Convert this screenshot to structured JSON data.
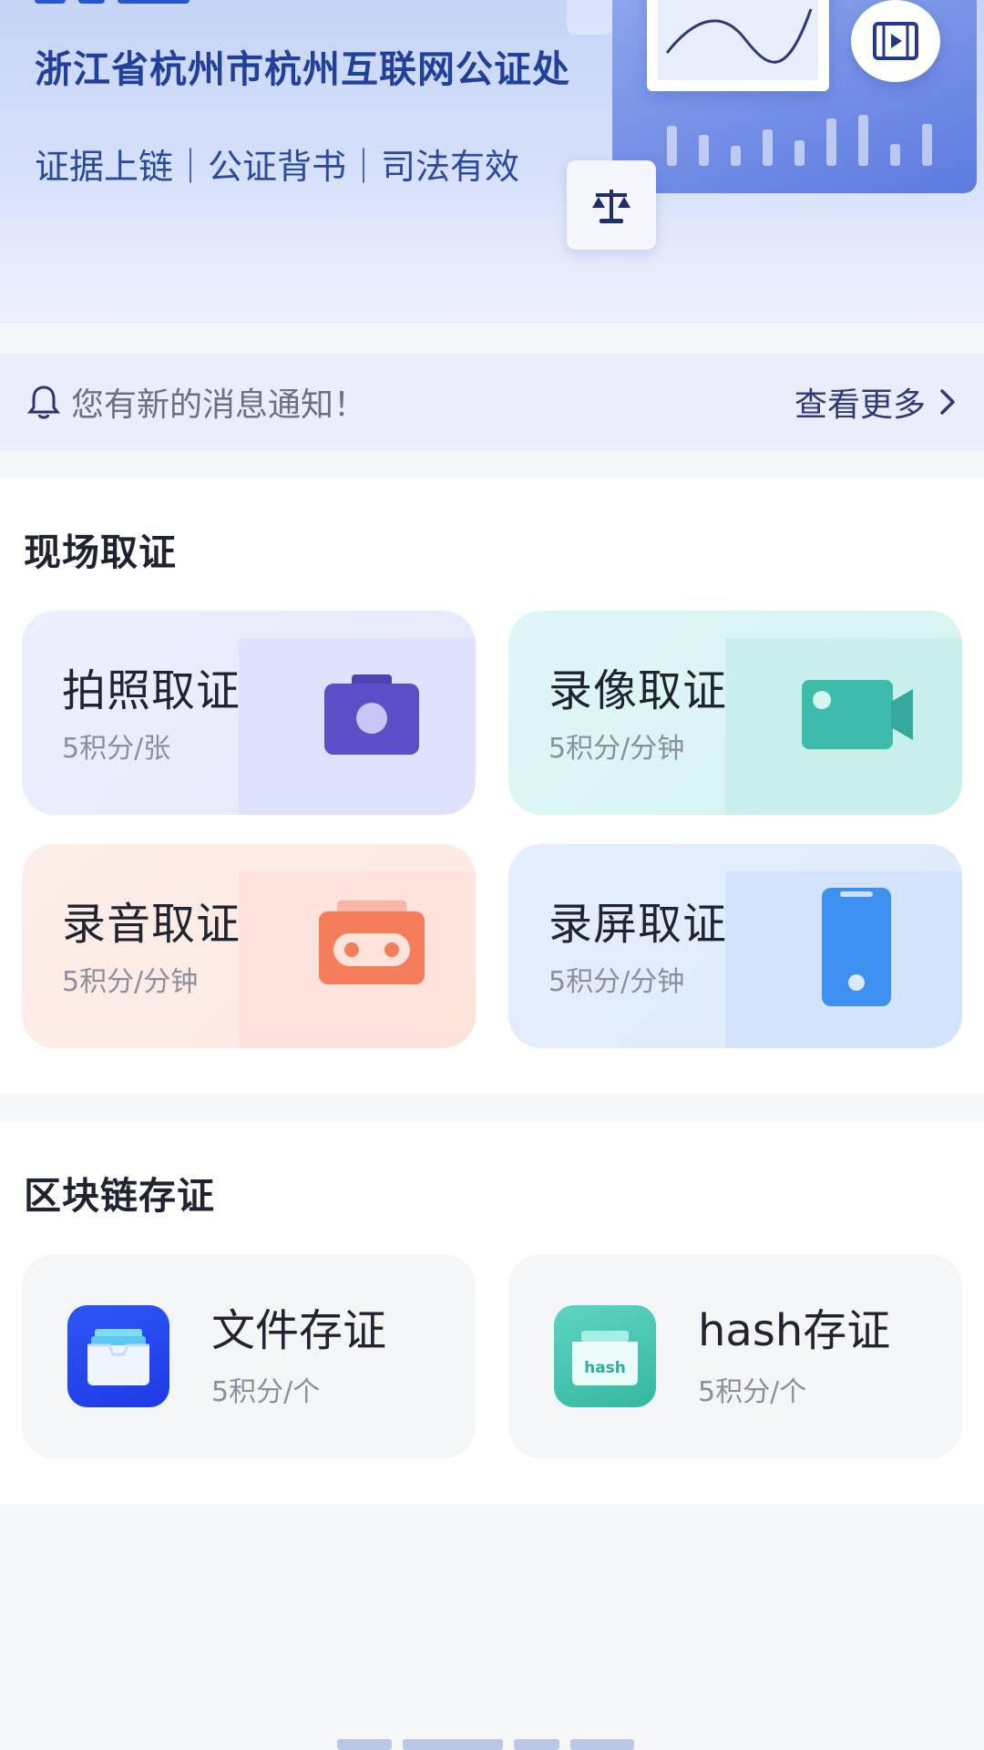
{
  "banner": {
    "organization": "浙江省杭州市杭州互联网公证处",
    "tags": "证据上链｜公证背书｜司法有效",
    "icons": [
      "chart-card",
      "film-icon",
      "scales-icon"
    ]
  },
  "notice": {
    "message": "您有新的消息通知！",
    "more_label": "查看更多",
    "icon": "bell-icon"
  },
  "onsite": {
    "title": "现场取证",
    "cards": [
      {
        "title": "拍照取证",
        "price": "5积分/张",
        "icon": "camera-icon",
        "accent": "#5a50c2"
      },
      {
        "title": "录像取证",
        "price": "5积分/分钟",
        "icon": "video-camera-icon",
        "accent": "#36b8a8"
      },
      {
        "title": "录音取证",
        "price": "5积分/分钟",
        "icon": "cassette-icon",
        "accent": "#f4785a"
      },
      {
        "title": "录屏取证",
        "price": "5积分/分钟",
        "icon": "phone-icon",
        "accent": "#3c8ef0"
      }
    ]
  },
  "blockchain": {
    "title": "区块链存证",
    "cards": [
      {
        "title": "文件存证",
        "price": "5积分/个",
        "icon": "file-box-icon",
        "accent": "#2448f0"
      },
      {
        "title": "hash存证",
        "price": "5积分/个",
        "icon": "hash-folder-icon",
        "accent": "#3fc1ac",
        "icon_text": "hash"
      }
    ]
  }
}
